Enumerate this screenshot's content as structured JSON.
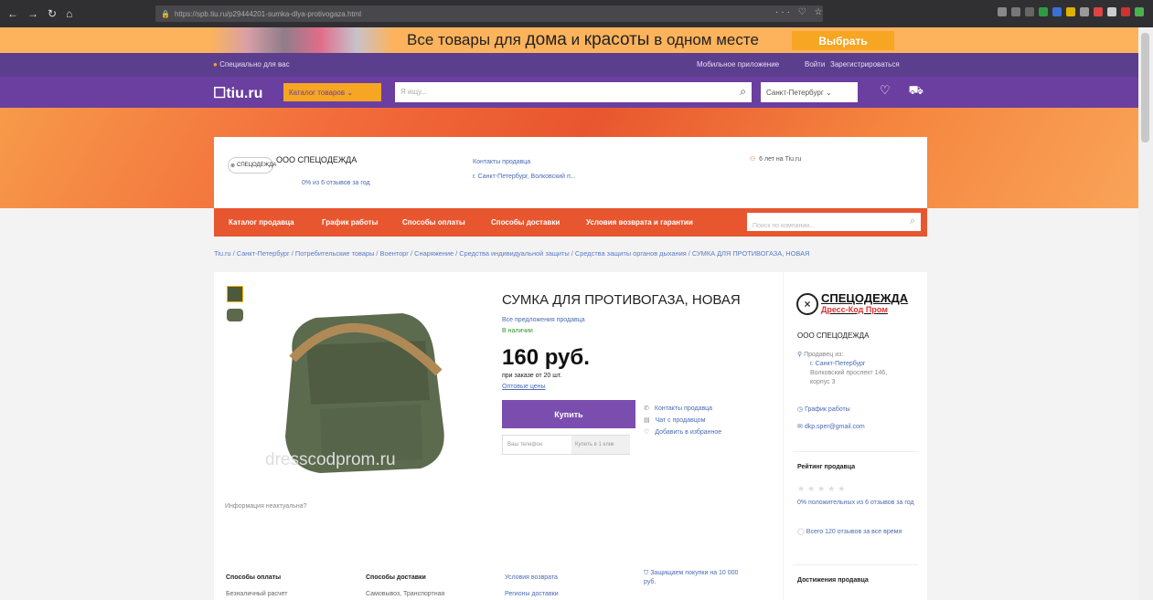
{
  "browser": {
    "url": "https://spb.tiu.ru/p29444201-sumka-dlya-protivogaza.html",
    "right_icons": "··· ♡ ☆"
  },
  "promo": {
    "text_a": "Все товары ",
    "text_b": "для ",
    "text_c": "дома",
    "text_d": " и ",
    "text_e": "красоты",
    "text_f": " в одном месте",
    "button": "Выбрать"
  },
  "topbar": {
    "special": "Специально для вас",
    "app": "Мобильное приложение",
    "login": "Войти",
    "register": "Зарегистрироваться"
  },
  "header": {
    "logo": "tiu.ru",
    "catalog": "Каталог товаров",
    "search_placeholder": "Я ищу...",
    "city": "Санкт-Петербург"
  },
  "seller_card": {
    "logo_text": "СПЕЦОДЕЖДА",
    "name": "ООО СПЕЦОДЕЖДА",
    "rating": "0% из 6 отзывов за год",
    "contacts_label": "Контакты продавца",
    "address_short": "г. Санкт-Петербург, Волковский п...",
    "years": "6 лет на Tiu.ru"
  },
  "seller_nav": {
    "items": [
      "Каталог продавца",
      "График работы",
      "Способы оплаты",
      "Способы доставки",
      "Условия возврата и гарантии"
    ],
    "search_placeholder": "Поиск по компании..."
  },
  "breadcrumbs": "Tiu.ru / Санкт-Петербург / Потребительские товары / Военторг / Снаряжение / Средства индивидуальной защиты / Средства защиты органов дыхания / СУМКА ДЛЯ ПРОТИВОГАЗА, НОВАЯ",
  "product": {
    "title": "СУМКА ДЛЯ ПРОТИВОГАЗА, НОВАЯ",
    "all_offers": "Все предложения продавца",
    "stock": "В наличии",
    "price": "160 руб.",
    "min_order": "при заказе от 20 шт.",
    "wholesale": "Оптовые цены",
    "buy": "Купить",
    "phone_placeholder": "Ваш телефон",
    "one_click": "Купить в 1 клик",
    "watermark": "dresscodprom.ru",
    "inaccurate": "Информация неактуальна?",
    "links": [
      "Контакты продавца",
      "Чат с продавцом",
      "Добавить в избранное"
    ]
  },
  "sidebar": {
    "logo_main": "СПЕЦОДЕЖДА",
    "logo_sub": "Дресс-Код Пром",
    "name": "ООО СПЕЦОДЕЖДА",
    "seller_from": "Продавец из:",
    "city": "г. Санкт-Петербург",
    "address": "Волковский проспект 146,",
    "address2": "корпус 3",
    "hours": "График работы",
    "email": "dkp.sper@gmail.com",
    "rating_title": "Рейтинг продавца",
    "rating_pct": "0% положительных из 6 отзывов за год",
    "all_reviews": "Всего 120 отзывов за все время",
    "achievements": "Достижения продавца"
  },
  "footer": {
    "pay_title": "Способы оплаты",
    "pay_value": "Безналичный расчет",
    "deliv_title": "Способы доставки",
    "deliv_value": "Самовывоз, Транспортная",
    "return": "Условия возврата",
    "regions": "Регионы доставки",
    "protect": "Защищаем покупки на 10 000 руб."
  }
}
